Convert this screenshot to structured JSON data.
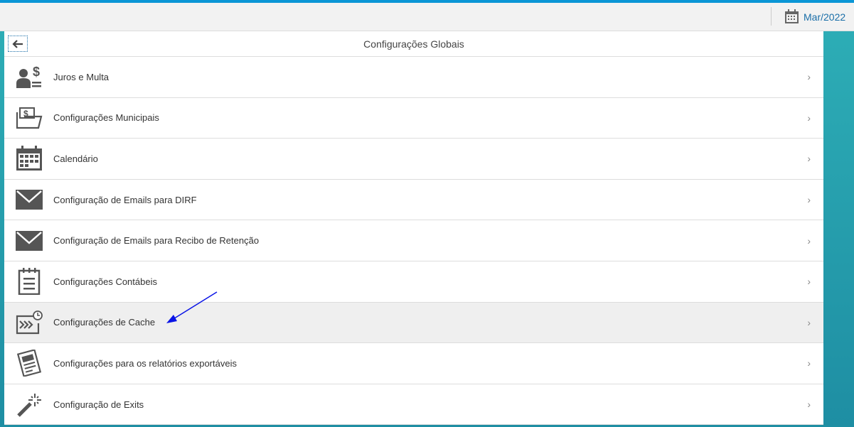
{
  "header": {
    "period": "Mar/2022"
  },
  "panel": {
    "title": "Configurações Globais"
  },
  "items": [
    {
      "label": "Juros e Multa",
      "icon": "person-dollar-icon"
    },
    {
      "label": "Configurações Municipais",
      "icon": "folder-money-icon"
    },
    {
      "label": "Calendário",
      "icon": "calendar-icon"
    },
    {
      "label": "Configuração de Emails para DIRF",
      "icon": "envelope-icon"
    },
    {
      "label": "Configuração de Emails para Recibo de Retenção",
      "icon": "envelope-icon"
    },
    {
      "label": "Configurações Contábeis",
      "icon": "notepad-icon"
    },
    {
      "label": "Configurações de Cache",
      "icon": "cache-clock-icon"
    },
    {
      "label": "Configurações para os relatórios exportáveis",
      "icon": "report-icon"
    },
    {
      "label": "Configuração de Exits",
      "icon": "magic-wand-icon"
    }
  ],
  "annotation_color": "#0a14e6"
}
